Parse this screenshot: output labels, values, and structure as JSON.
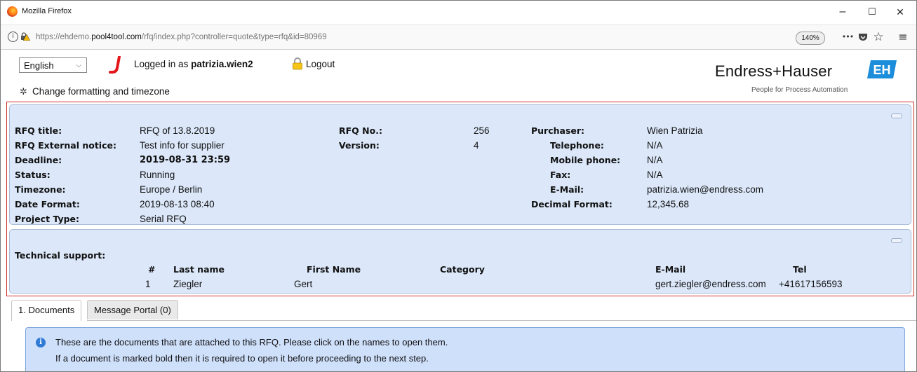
{
  "window": {
    "title": "Mozilla Firefox",
    "controls": {
      "minimize": "–",
      "maximize": "☐",
      "close": "✕"
    }
  },
  "urlbar": {
    "url_prefix": "https://ehdemo.",
    "url_domain": "pool4tool.com",
    "url_path": "/rfq/index.php?controller=quote&type=rfq&id=80969",
    "zoom": "140%",
    "more_icon": "•••",
    "pocket_icon": "pocket-icon",
    "bookmark_icon": "☆",
    "menu_icon": "≡"
  },
  "header": {
    "language": "English",
    "logged_in_prefix": "Logged in as ",
    "username": "patrizia.wien2",
    "logout_label": "Logout",
    "change_format_label": "Change formatting and timezone",
    "brand_name": "Endress+Hauser",
    "brand_tagline": "People for Process Automation",
    "brand_badge": "EH",
    "brand_color": "#1b8ddb"
  },
  "rfq": {
    "left": [
      {
        "label": "RFQ title:",
        "value": "RFQ of 13.8.2019",
        "bold": false
      },
      {
        "label": "RFQ External notice:",
        "value": "Test info for supplier",
        "bold": false
      },
      {
        "label": "Deadline:",
        "value": "2019-08-31 23:59",
        "bold": true
      },
      {
        "label": "Status:",
        "value": "Running",
        "bold": false
      },
      {
        "label": "Timezone:",
        "value": "Europe / Berlin",
        "bold": false
      },
      {
        "label": "Date Format:",
        "value": "2019-08-13 08:40",
        "bold": false
      },
      {
        "label": "Project Type:",
        "value": "Serial RFQ",
        "bold": false
      }
    ],
    "middle": [
      {
        "label": "RFQ No.:",
        "value": "256"
      },
      {
        "label": "Version:",
        "value": "4"
      }
    ],
    "right": [
      {
        "label": "Purchaser:",
        "value": "Wien Patrizia"
      },
      {
        "label": "Telephone:",
        "value": "N/A"
      },
      {
        "label": "Mobile phone:",
        "value": "N/A"
      },
      {
        "label": "Fax:",
        "value": "N/A"
      },
      {
        "label": "E-Mail:",
        "value": "patrizia.wien@endress.com"
      },
      {
        "label": "Decimal Format:",
        "value": "12,345.68"
      }
    ]
  },
  "support": {
    "title": "Technical support:",
    "columns": [
      "#",
      "Last name",
      "First Name",
      "Category",
      "E-Mail",
      "Tel"
    ],
    "rows": [
      [
        "1",
        "Ziegler",
        "Gert",
        "",
        "gert.ziegler@endress.com",
        "+41617156593"
      ]
    ]
  },
  "tabs": [
    {
      "label": "1. Documents",
      "active": true
    },
    {
      "label": "Message Portal (0)",
      "active": false
    }
  ],
  "documents_info": {
    "line1": "These are the documents that are attached to this RFQ. Please click on the names to open them.",
    "line2": "If a document is marked bold then it is required to open it before proceeding to the next step."
  }
}
